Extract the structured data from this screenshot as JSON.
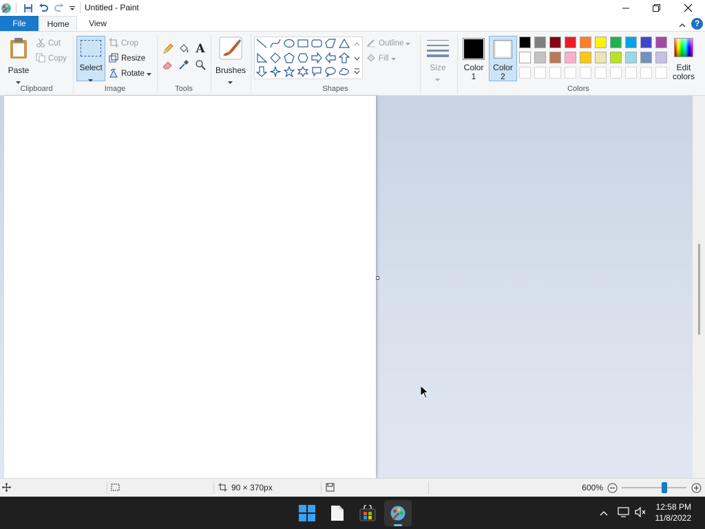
{
  "window": {
    "title": "Untitled - Paint",
    "quick_access": [
      "paint-app-icon",
      "save-icon",
      "undo-icon",
      "redo-icon",
      "customize-qat-icon"
    ]
  },
  "tabs": [
    {
      "label": "File",
      "active": false
    },
    {
      "label": "Home",
      "active": true
    },
    {
      "label": "View",
      "active": false
    }
  ],
  "ribbon": {
    "clipboard": {
      "group_label": "Clipboard",
      "paste_label": "Paste",
      "cut_label": "Cut",
      "copy_label": "Copy"
    },
    "image": {
      "group_label": "Image",
      "select_label": "Select",
      "crop_label": "Crop",
      "resize_label": "Resize",
      "rotate_label": "Rotate"
    },
    "tools": {
      "group_label": "Tools",
      "items": [
        "pencil-icon",
        "fill-bucket-icon",
        "text-icon",
        "eraser-icon",
        "color-picker-icon",
        "magnifier-icon"
      ]
    },
    "brushes": {
      "label": "Brushes"
    },
    "shapes": {
      "group_label": "Shapes",
      "outline_label": "Outline",
      "fill_label": "Fill"
    },
    "size": {
      "label": "Size"
    },
    "colors": {
      "group_label": "Colors",
      "color1_label": "Color",
      "color1_num": "1",
      "color2_label": "Color",
      "color2_num": "2",
      "color1_value": "#000000",
      "color2_value": "#ffffff",
      "edit_label_1": "Edit",
      "edit_label_2": "colors",
      "palette_row1": [
        "#000000",
        "#7f7f7f",
        "#880015",
        "#ed1c24",
        "#ff7f27",
        "#fff200",
        "#22b14c",
        "#00a2e8",
        "#3f48cc",
        "#a349a4"
      ],
      "palette_row2": [
        "#ffffff",
        "#c3c3c3",
        "#b97a57",
        "#ffaec9",
        "#ffc90e",
        "#efe4b0",
        "#b5e61d",
        "#99d9ea",
        "#7092be",
        "#c8bfe7"
      ],
      "palette_row3": [
        "",
        "",
        "",
        "",
        "",
        "",
        "",
        "",
        "",
        ""
      ]
    }
  },
  "statusbar": {
    "size_text": "90 × 370px",
    "zoom_text": "600%",
    "zoom_level": 0.66
  },
  "taskbar": {
    "apps": [
      "start-icon",
      "file-explorer-icon",
      "store-icon",
      "paint-taskbar-icon"
    ],
    "time": "12:58 PM",
    "date": "11/8/2022"
  }
}
